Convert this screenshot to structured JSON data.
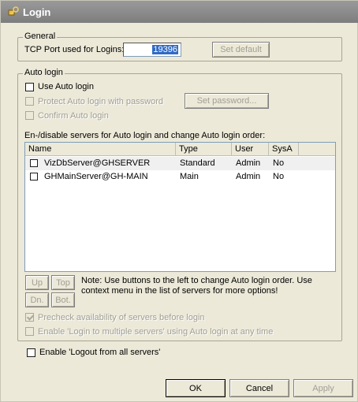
{
  "window": {
    "title": "Login",
    "icon": "login-key-icon"
  },
  "general": {
    "legend": "General",
    "tcp_label": "TCP Port used for Logins:",
    "tcp_value": "19396",
    "set_default": "Set default"
  },
  "auto_login": {
    "legend": "Auto login",
    "use_auto_login": "Use Auto login",
    "protect_password": "Protect Auto login with password",
    "set_password": "Set password...",
    "confirm_auto_login": "Confirm Auto login",
    "servers_label": "En-/disable servers for Auto login and change Auto login order:",
    "columns": [
      "Name",
      "Type",
      "User",
      "SysA"
    ],
    "servers": [
      {
        "name": "VizDbServer@GHSERVER",
        "type": "Standard",
        "user": "Admin",
        "sysa": "No"
      },
      {
        "name": "GHMainServer@GH-MAIN",
        "type": "Main",
        "user": "Admin",
        "sysa": "No"
      }
    ],
    "up": "Up",
    "top": "Top",
    "dn": "Dn.",
    "bot": "Bot.",
    "note": "Note: Use buttons to the left to change Auto login order. Use context menu in the list of servers for more options!",
    "precheck": "Precheck availability of servers before login",
    "enable_multiple": "Enable 'Login to multiple servers' using Auto login at any time"
  },
  "logout_all": "Enable 'Logout from all servers'",
  "buttons": {
    "ok": "OK",
    "cancel": "Cancel",
    "apply": "Apply"
  }
}
